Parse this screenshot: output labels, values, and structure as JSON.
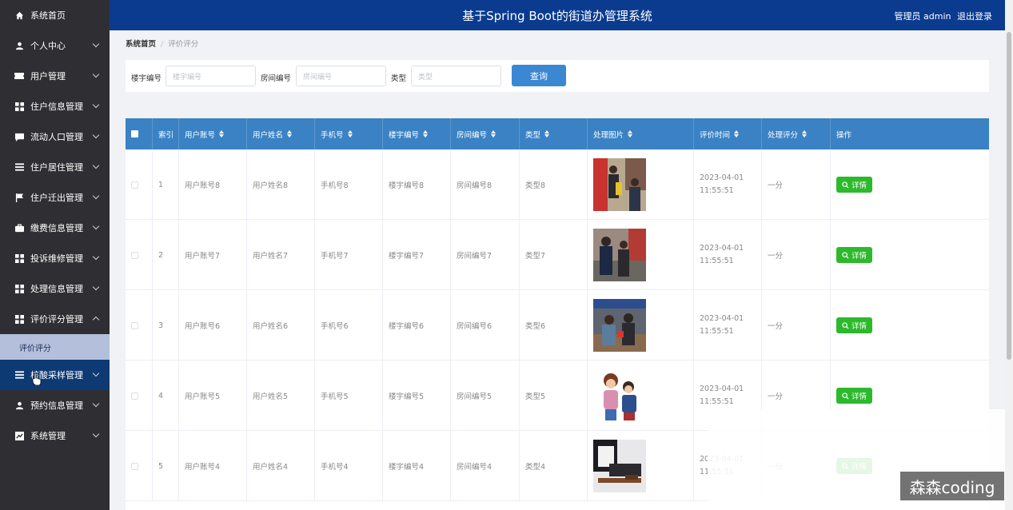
{
  "header": {
    "title": "基于Spring Boot的街道办管理系统",
    "user_role": "管理员 admin",
    "logout_label": "退出登录"
  },
  "sidebar": {
    "items": [
      {
        "label": "系统首页",
        "icon": "home-icon"
      },
      {
        "label": "个人中心",
        "icon": "person-icon"
      },
      {
        "label": "用户管理",
        "icon": "ticket-icon"
      },
      {
        "label": "住户信息管理",
        "icon": "grid-icon"
      },
      {
        "label": "流动人口管理",
        "icon": "chat-icon"
      },
      {
        "label": "住户居住管理",
        "icon": "list-icon"
      },
      {
        "label": "住户迁出管理",
        "icon": "flag-icon"
      },
      {
        "label": "缴费信息管理",
        "icon": "briefcase-icon"
      },
      {
        "label": "投诉维修管理",
        "icon": "grid-icon"
      },
      {
        "label": "处理信息管理",
        "icon": "grid-icon"
      },
      {
        "label": "评价评分管理",
        "icon": "grid-icon"
      },
      {
        "label": "核酸采样管理",
        "icon": "list-icon"
      },
      {
        "label": "预约信息管理",
        "icon": "person-icon"
      },
      {
        "label": "系统管理",
        "icon": "chart-icon"
      }
    ],
    "submenu_active": "评价评分"
  },
  "breadcrumb": {
    "home": "系统首页",
    "current": "评价评分"
  },
  "search": {
    "building_label": "楼宇编号",
    "building_placeholder": "楼宇编号",
    "room_label": "房间编号",
    "room_placeholder": "房间编号",
    "type_label": "类型",
    "type_placeholder": "类型",
    "query_label": "查询"
  },
  "table": {
    "columns": [
      "索引",
      "用户账号",
      "用户姓名",
      "手机号",
      "楼宇编号",
      "房间编号",
      "类型",
      "处理图片",
      "评价时间",
      "处理评分",
      "操作"
    ],
    "detail_label": "详情",
    "rows": [
      {
        "index": "1",
        "account": "用户账号8",
        "name": "用户姓名8",
        "phone": "手机号8",
        "building": "楼宇编号8",
        "room": "房间编号8",
        "type": "类型8",
        "time": "2023-04-01 11:55:51",
        "score": "一分"
      },
      {
        "index": "2",
        "account": "用户账号7",
        "name": "用户姓名7",
        "phone": "手机号7",
        "building": "楼宇编号7",
        "room": "房间编号7",
        "type": "类型7",
        "time": "2023-04-01 11:55:51",
        "score": "一分"
      },
      {
        "index": "3",
        "account": "用户账号6",
        "name": "用户姓名6",
        "phone": "手机号6",
        "building": "楼宇编号6",
        "room": "房间编号6",
        "type": "类型6",
        "time": "2023-04-01 11:55:51",
        "score": "一分"
      },
      {
        "index": "4",
        "account": "用户账号5",
        "name": "用户姓名5",
        "phone": "手机号5",
        "building": "楼宇编号5",
        "room": "房间编号5",
        "type": "类型5",
        "time": "2023-04-01 11:55:51",
        "score": "一分"
      },
      {
        "index": "5",
        "account": "用户账号4",
        "name": "用户姓名4",
        "phone": "手机号4",
        "building": "楼宇编号4",
        "room": "房间编号4",
        "type": "类型4",
        "time": "2023-04-01 11:55:51",
        "score": "一分"
      }
    ]
  },
  "watermark": "森森coding",
  "colors": {
    "sidebar_bg": "#2f2f33",
    "header_bg": "#0a3b8f",
    "table_header_bg": "#3a82c4",
    "query_button": "#3b87d2",
    "detail_button": "#2cb92c",
    "submenu_active_bg": "#b4bfdc"
  }
}
